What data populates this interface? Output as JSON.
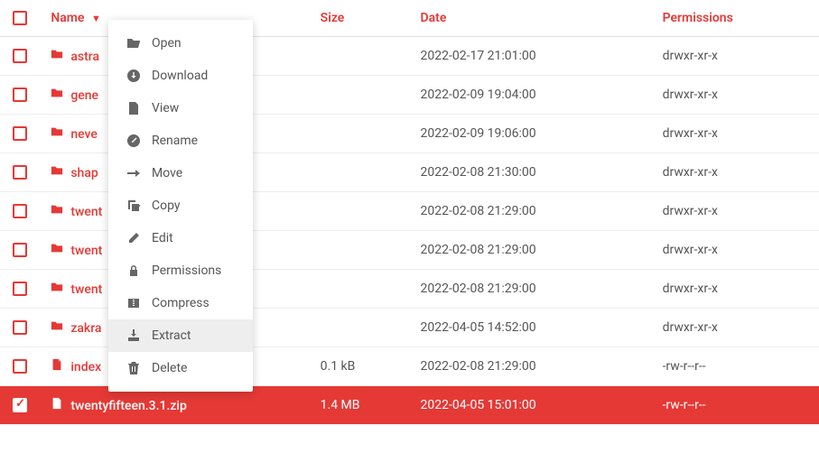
{
  "columns": {
    "name": "Name",
    "size": "Size",
    "date": "Date",
    "perms": "Permissions"
  },
  "sort_indicator": "▼",
  "rows": [
    {
      "type": "folder",
      "name": "astra",
      "size": "",
      "date": "2022-02-17 21:01:00",
      "perms": "drwxr-xr-x",
      "selected": false
    },
    {
      "type": "folder",
      "name": "gene",
      "size": "",
      "date": "2022-02-09 19:04:00",
      "perms": "drwxr-xr-x",
      "selected": false
    },
    {
      "type": "folder",
      "name": "neve",
      "size": "",
      "date": "2022-02-09 19:06:00",
      "perms": "drwxr-xr-x",
      "selected": false
    },
    {
      "type": "folder",
      "name": "shap",
      "size": "",
      "date": "2022-02-08 21:30:00",
      "perms": "drwxr-xr-x",
      "selected": false
    },
    {
      "type": "folder",
      "name": "twent",
      "size": "",
      "date": "2022-02-08 21:29:00",
      "perms": "drwxr-xr-x",
      "selected": false
    },
    {
      "type": "folder",
      "name": "twent",
      "size": "",
      "date": "2022-02-08 21:29:00",
      "perms": "drwxr-xr-x",
      "selected": false
    },
    {
      "type": "folder",
      "name": "twent",
      "size": "",
      "date": "2022-02-08 21:29:00",
      "perms": "drwxr-xr-x",
      "selected": false
    },
    {
      "type": "folder",
      "name": "zakra",
      "size": "",
      "date": "2022-04-05 14:52:00",
      "perms": "drwxr-xr-x",
      "selected": false
    },
    {
      "type": "file",
      "name": "index",
      "size": "0.1 kB",
      "date": "2022-02-08 21:29:00",
      "perms": "-rw-r--r--",
      "selected": false
    },
    {
      "type": "zip",
      "name": "twentyfifteen.3.1.zip",
      "size": "1.4 MB",
      "date": "2022-04-05 15:01:00",
      "perms": "-rw-r--r--",
      "selected": true
    }
  ],
  "context_menu": {
    "items": [
      {
        "icon": "open",
        "label": "Open",
        "hovered": false
      },
      {
        "icon": "download",
        "label": "Download",
        "hovered": false
      },
      {
        "icon": "view",
        "label": "View",
        "hovered": false
      },
      {
        "icon": "rename",
        "label": "Rename",
        "hovered": false
      },
      {
        "icon": "move",
        "label": "Move",
        "hovered": false
      },
      {
        "icon": "copy",
        "label": "Copy",
        "hovered": false
      },
      {
        "icon": "edit",
        "label": "Edit",
        "hovered": false
      },
      {
        "icon": "permissions",
        "label": "Permissions",
        "hovered": false
      },
      {
        "icon": "compress",
        "label": "Compress",
        "hovered": false
      },
      {
        "icon": "extract",
        "label": "Extract",
        "hovered": true
      },
      {
        "icon": "delete",
        "label": "Delete",
        "hovered": false
      }
    ]
  }
}
